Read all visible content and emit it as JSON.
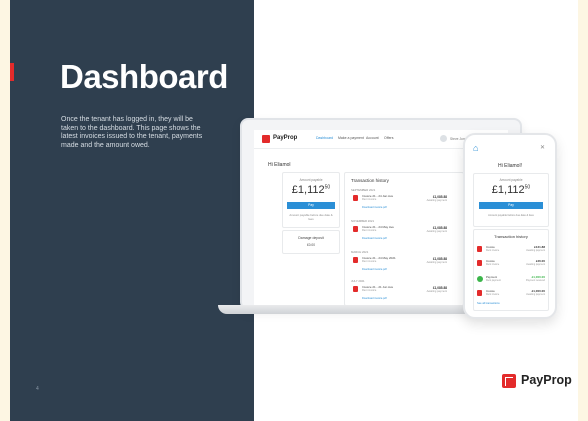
{
  "slide": {
    "title": "Dashboard",
    "description": "Once the tenant has logged in, they will be taken to the dashboard. This page shows the latest invoices issued to the tenant, payments made and the amount owed.",
    "page_number": "4"
  },
  "brand": {
    "name": "PayProp",
    "accent": "#e32b2b"
  },
  "laptop": {
    "logo_text": "PayProp",
    "nav": [
      "Dashboard",
      "Make a payment",
      "Account",
      "Offers"
    ],
    "user": "Steve Jones ▾",
    "greeting": "Hi Eliamol",
    "amount_label": "Amount payable",
    "amount": "£1,112",
    "amount_pence": "50",
    "pay_label": "Pay",
    "amount_note": "Amount payable before due date & fees",
    "deposit_label": "Damage deposit",
    "deposit_value": "£0.00",
    "tx_title": "Transaction history",
    "transactions": [
      {
        "date": "SEPTEMBER 2021",
        "name": "Invoice 21 - 24 Jan Ave",
        "sub": "Rent invoice",
        "amount": "£1,085.88",
        "status": "Awaiting payment",
        "link": "Download invoice.pdf"
      },
      {
        "date": "NOVEMBER 2021",
        "name": "Invoice 21 - 24 May Ave",
        "sub": "Rent invoice",
        "amount": "£1,085.88",
        "status": "Awaiting payment",
        "link": "Download invoice.pdf"
      },
      {
        "date": "MARCH 2021",
        "name": "Invoice 21 - 24 May 2021",
        "sub": "Rent invoice",
        "amount": "£1,085.88",
        "status": "Awaiting payment",
        "link": "Download invoice.pdf"
      },
      {
        "date": "JULY 2021",
        "name": "Invoice 21 - 21 Jun Ave",
        "sub": "Rent invoice",
        "amount": "£1,085.88",
        "status": "Awaiting payment",
        "link": "Download invoice.pdf"
      }
    ]
  },
  "phone": {
    "greeting": "Hi Eliamol!",
    "amount_label": "Amount payable",
    "amount": "£1,112",
    "amount_pence": "50",
    "pay_label": "Pay",
    "amount_note": "Amount payable before due date & fees",
    "tx_title": "Transaction history",
    "rows": [
      {
        "icon": "invoice",
        "name": "Invoice",
        "sub": "Rent invoice",
        "amount": "£121.88",
        "status": "Awaiting payment"
      },
      {
        "icon": "invoice",
        "name": "Invoice",
        "sub": "Rent invoice",
        "amount": "£46.00",
        "status": "Awaiting payment"
      },
      {
        "icon": "check",
        "name": "Payment",
        "sub": "Rent payment",
        "amount": "£1,000.00",
        "status": "Payment received"
      },
      {
        "icon": "invoice",
        "name": "Invoice",
        "sub": "Rent invoice",
        "amount": "£1,000.00",
        "status": "Awaiting payment"
      }
    ],
    "see_all": "See all transactions"
  }
}
